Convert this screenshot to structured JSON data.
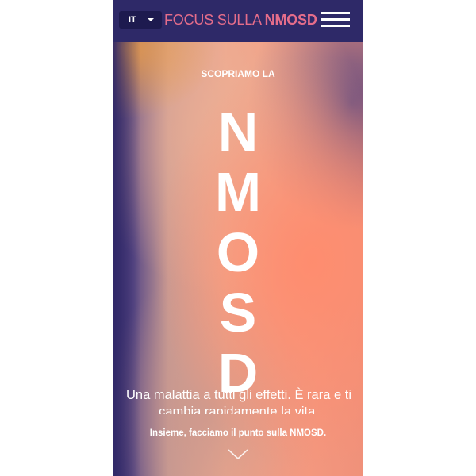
{
  "header": {
    "language": "IT",
    "brand_prefix": "FOCUS SULLA ",
    "brand_emphasis": "NMOSD",
    "icons": {
      "language_dropdown": "chevron-down-icon",
      "menu": "hamburger-menu-icon"
    }
  },
  "hero": {
    "eyebrow": "SCOPRIAMO LA",
    "letters": [
      "N",
      "M",
      "O",
      "S",
      "D"
    ],
    "tagline": "Una malattia a tutti gli effetti. È rara e ti cambia rapidamente la vita.",
    "cta": "Insieme, facciamo il punto sulla NMOSD.",
    "scroll_icon": "chevron-down-icon"
  },
  "colors": {
    "header_background": "#2e2968",
    "brand_accent": "#e56d8a",
    "text": "#ffffff"
  }
}
